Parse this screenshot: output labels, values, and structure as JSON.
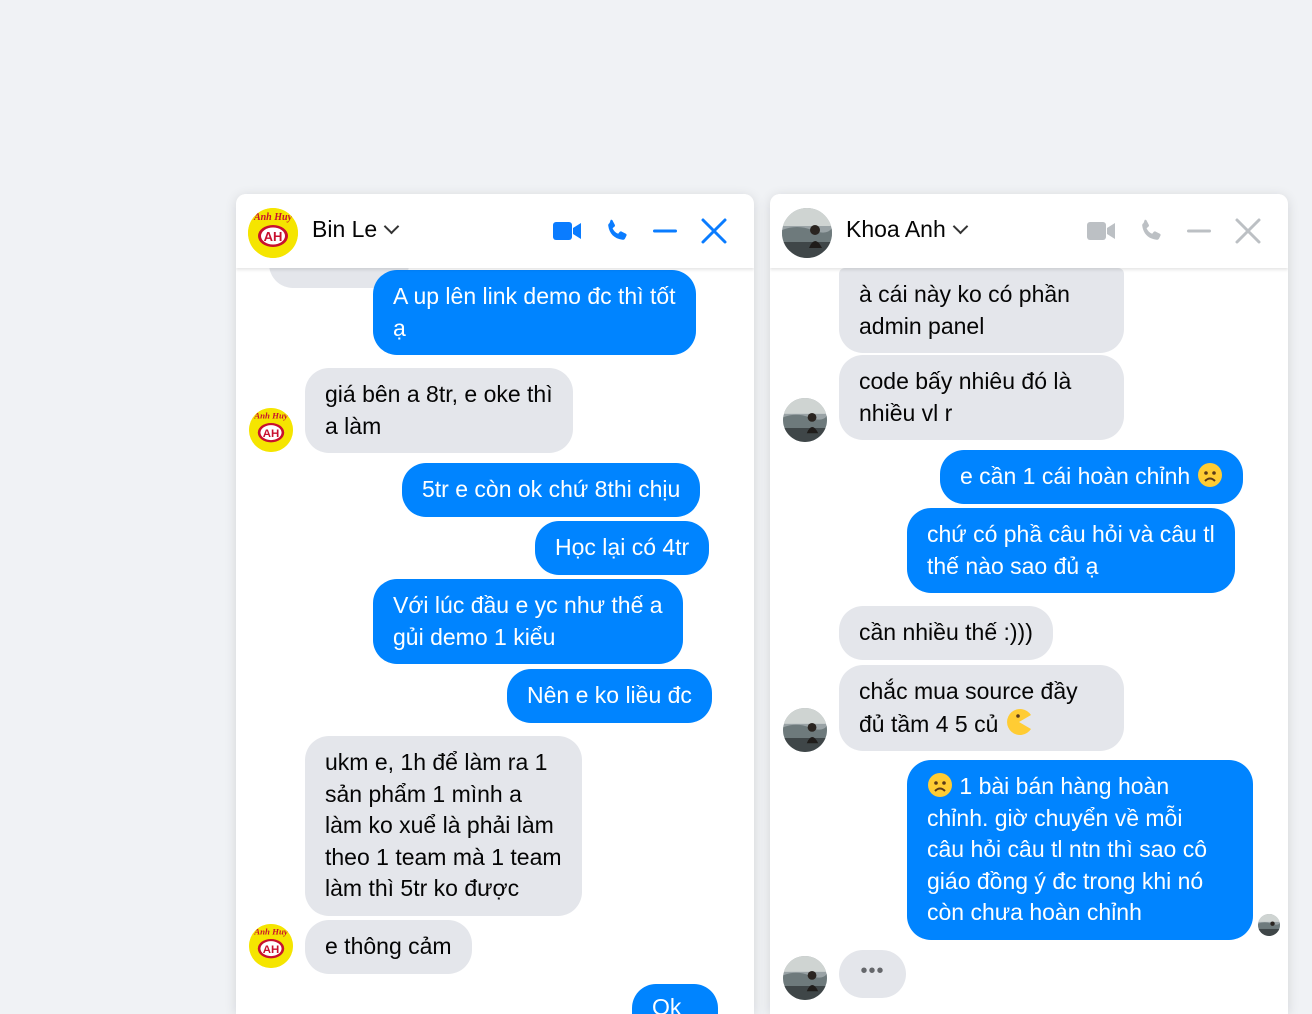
{
  "chat1": {
    "contact_name": "Bin Le",
    "avatar_badge": "AH",
    "avatar_arc_text": "Anh Huy",
    "messages": [
      {
        "from": "me",
        "lines": [
          "A up lên link demo đc thì tốt",
          "ạ"
        ]
      },
      {
        "from": "them",
        "lines": [
          "giá bên a 8tr, e oke thì",
          "a làm"
        ]
      },
      {
        "from": "me",
        "lines": [
          "5tr e còn ok chứ 8thi chịu"
        ]
      },
      {
        "from": "me",
        "lines": [
          "Học lại có 4tr"
        ]
      },
      {
        "from": "me",
        "lines": [
          "Với lúc đầu e yc như thế a",
          "gủi demo 1 kiểu"
        ]
      },
      {
        "from": "me",
        "lines": [
          "Nên e ko liều đc"
        ]
      },
      {
        "from": "them",
        "lines": [
          "ukm e, 1h để làm ra 1",
          "sản phẩm 1 mình a",
          "làm ko xuể là phải làm",
          "theo 1 team mà 1 team",
          "làm thì 5tr ko được"
        ]
      },
      {
        "from": "them",
        "lines": [
          "e thông cảm"
        ]
      },
      {
        "from": "me",
        "lines": [
          "Ok"
        ]
      }
    ]
  },
  "chat2": {
    "contact_name": "Khoa Anh",
    "messages": [
      {
        "from": "them",
        "lines": [
          "à cái này ko có phần",
          "admin panel"
        ]
      },
      {
        "from": "them",
        "lines": [
          "code bấy nhiêu đó là",
          "nhiều vl r"
        ]
      },
      {
        "from": "me",
        "lines": [
          "e cần 1 cái hoàn chỉnh"
        ]
      },
      {
        "from": "me",
        "lines": [
          "chứ có phầ câu hỏi và câu tl",
          "thế nào sao đủ ạ"
        ]
      },
      {
        "from": "them",
        "lines": [
          "cần nhiều thế :)))"
        ]
      },
      {
        "from": "them",
        "lines": [
          "chắc mua source đầy",
          "đủ tầm 4 5 củ"
        ]
      },
      {
        "from": "me",
        "lines": [
          "1 bài bán hàng hoàn",
          "chỉnh. giờ chuyển về mỗi",
          "câu hỏi câu tl ntn thì sao cô",
          "giáo đồng ý đc trong khi nó",
          "còn chưa hoàn chỉnh"
        ]
      }
    ],
    "typing_indicator": "•••"
  },
  "colors": {
    "outgoing": "#0084ff",
    "incoming": "#e4e6eb",
    "accent_active": "#0a7cff",
    "icon_inactive": "#bcc0c4"
  },
  "icons": {
    "video": "video-camera-icon",
    "call": "phone-icon",
    "minimize": "minimize-icon",
    "close": "close-icon",
    "sad_emoji": "frowning-face-emoji",
    "pacman_emoji": "pacman-emoji"
  }
}
